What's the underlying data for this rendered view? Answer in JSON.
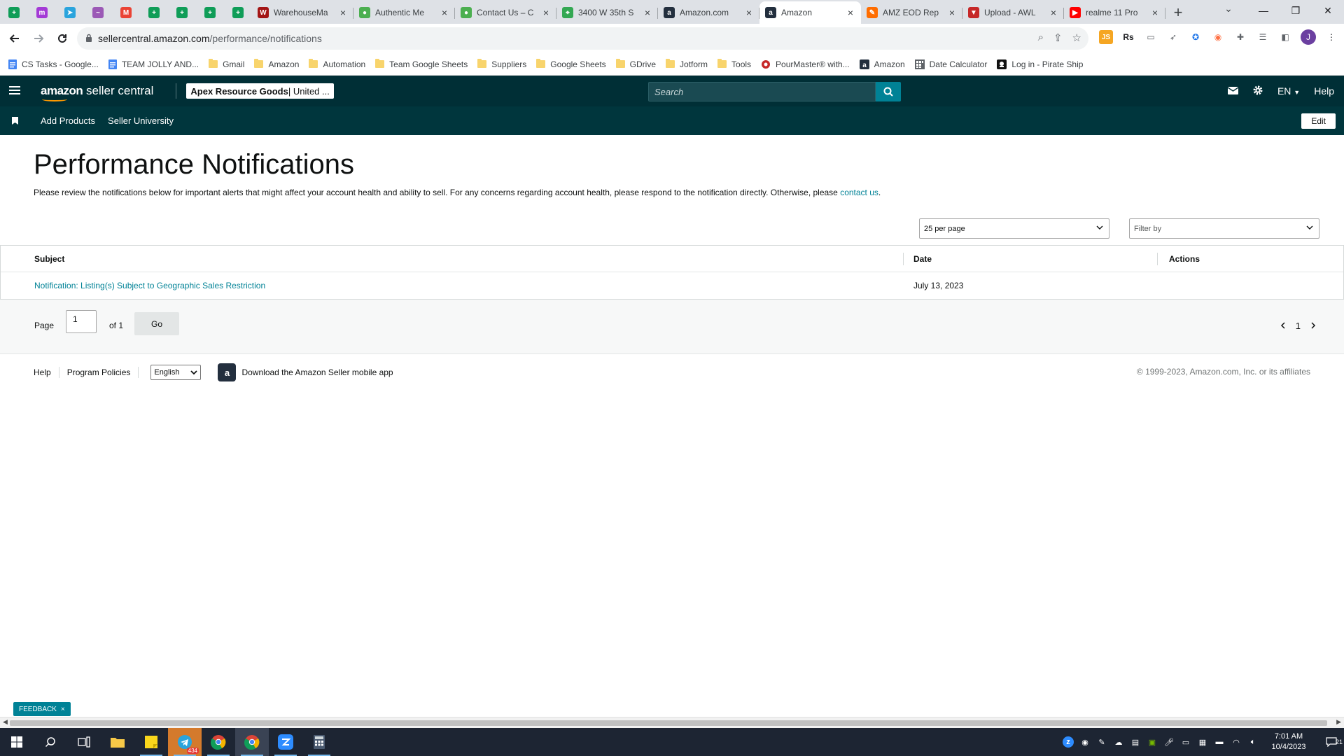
{
  "browser": {
    "tabs": [
      {
        "title": "",
        "pinned": true,
        "color": "#0f9d58",
        "glyph": "+"
      },
      {
        "title": "",
        "pinned": true,
        "color": "#a43ad6",
        "glyph": "m"
      },
      {
        "title": "",
        "pinned": true,
        "color": "#2aa4dd",
        "glyph": "➤"
      },
      {
        "title": "",
        "pinned": true,
        "color": "#9b59b6",
        "glyph": "~"
      },
      {
        "title": "",
        "pinned": true,
        "color": "#ea4335",
        "glyph": "M"
      },
      {
        "title": "",
        "pinned": true,
        "color": "#0f9d58",
        "glyph": "+"
      },
      {
        "title": "",
        "pinned": true,
        "color": "#0f9d58",
        "glyph": "+"
      },
      {
        "title": "",
        "pinned": true,
        "color": "#0f9d58",
        "glyph": "+"
      },
      {
        "title": "",
        "pinned": true,
        "color": "#0f9d58",
        "glyph": "+"
      },
      {
        "title": "WarehouseMa",
        "pinned": false,
        "color": "#a31515",
        "glyph": "W"
      },
      {
        "title": "Authentic Me",
        "pinned": false,
        "color": "#4caf50",
        "glyph": "●"
      },
      {
        "title": "Contact Us – C",
        "pinned": false,
        "color": "#4caf50",
        "glyph": "●"
      },
      {
        "title": "3400 W 35th S",
        "pinned": false,
        "color": "#34a853",
        "glyph": "⌖"
      },
      {
        "title": "Amazon.com",
        "pinned": false,
        "color": "#232f3e",
        "glyph": "a"
      },
      {
        "title": "Amazon",
        "pinned": false,
        "color": "#232f3e",
        "glyph": "a",
        "active": true
      },
      {
        "title": "AMZ EOD Rep",
        "pinned": false,
        "color": "#ff6d00",
        "glyph": "✎"
      },
      {
        "title": "Upload - AWL",
        "pinned": false,
        "color": "#c62828",
        "glyph": "▼"
      },
      {
        "title": "realme 11 Pro",
        "pinned": false,
        "color": "#ff0000",
        "glyph": "▶"
      }
    ],
    "close_glyph": "×",
    "new_tab_glyph": "+",
    "url_host": "sellercentral.amazon.com",
    "url_path": "/performance/notifications",
    "profile_initial": "J",
    "bookmarks": [
      {
        "label": "CS Tasks - Google...",
        "icon": "doc"
      },
      {
        "label": "TEAM JOLLY AND...",
        "icon": "doc"
      },
      {
        "label": "Gmail",
        "icon": "folder"
      },
      {
        "label": "Amazon",
        "icon": "folder"
      },
      {
        "label": "Automation",
        "icon": "folder"
      },
      {
        "label": "Team Google Sheets",
        "icon": "folder"
      },
      {
        "label": "Suppliers",
        "icon": "folder"
      },
      {
        "label": "Google Sheets",
        "icon": "folder"
      },
      {
        "label": "GDrive",
        "icon": "folder"
      },
      {
        "label": "Jotform",
        "icon": "folder"
      },
      {
        "label": "Tools",
        "icon": "folder"
      },
      {
        "label": "PourMaster® with...",
        "icon": "pour"
      },
      {
        "label": "Amazon",
        "icon": "amazon"
      },
      {
        "label": "Date Calculator",
        "icon": "calc"
      },
      {
        "label": "Log in - Pirate Ship",
        "icon": "pirate"
      }
    ]
  },
  "header": {
    "logo_amazon": "amazon",
    "logo_suffix": " seller central",
    "account_name": "Apex Resource Goods",
    "account_market": " | United ...",
    "search_placeholder": "Search",
    "lang": "EN",
    "help": "Help",
    "subnav": [
      "Add Products",
      "Seller University"
    ],
    "edit": "Edit"
  },
  "main": {
    "title": "Performance Notifications",
    "description": "Please review the notifications below for important alerts that might affect your account health and ability to sell. For any concerns regarding account health, please respond to the notification directly. Otherwise, please ",
    "contact_link": "contact us",
    "description_end": ".",
    "per_page": "25 per page",
    "filter_placeholder": "Filter by",
    "columns": {
      "subject": "Subject",
      "date": "Date",
      "actions": "Actions"
    },
    "rows": [
      {
        "subject": "Notification: Listing(s) Subject to Geographic Sales Restriction",
        "date": "July 13, 2023",
        "actions": ""
      }
    ],
    "pager": {
      "label": "Page",
      "current": "1",
      "of": "of 1",
      "go": "Go",
      "page_number": "1"
    }
  },
  "footer": {
    "help": "Help",
    "program_policies": "Program Policies",
    "language": "English",
    "app_text": "Download the Amazon Seller mobile app",
    "copyright": "© 1999-2023, Amazon.com, Inc. or its affiliates"
  },
  "feedback": {
    "label": "FEEDBACK",
    "close": "×"
  },
  "taskbar": {
    "time": "7:01 AM",
    "date": "10/4/2023",
    "telegram_badge": "434",
    "notification_count": "21"
  }
}
